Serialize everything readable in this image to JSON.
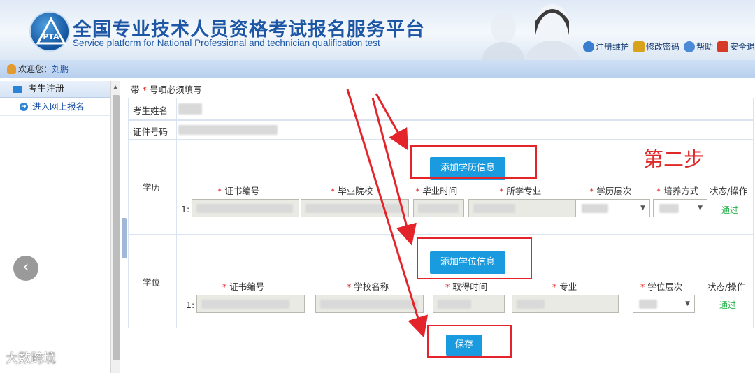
{
  "header": {
    "title_cn": "全国专业技术人员资格考试报名服务平台",
    "title_en": "Service platform for National Professional and technician qualification test",
    "logo_text": "PTA",
    "links": [
      "注册维护",
      "修改密码",
      "帮助",
      "安全退"
    ]
  },
  "welcome": {
    "prefix": "欢迎您：",
    "user": "刘鹏"
  },
  "sidebar": {
    "section": "考生注册",
    "item": "进入网上报名",
    "nav_glyph": "‹"
  },
  "form": {
    "hint_prefix": "带",
    "hint_star": "*",
    "hint_suffix": "号项必须填写",
    "name_label": "考生姓名",
    "id_label": "证件号码",
    "edu": {
      "label": "学历",
      "add_button": "添加学历信息",
      "columns": [
        "证书编号",
        "毕业院校",
        "毕业时间",
        "所学专业",
        "学历层次",
        "培养方式",
        "状态/操作"
      ],
      "row_no": "1:",
      "status": "通过"
    },
    "degree": {
      "label": "学位",
      "add_button": "添加学位信息",
      "columns": [
        "证书编号",
        "学校名称",
        "取得时间",
        "专业",
        "学位层次",
        "状态/操作"
      ],
      "row_no": "1:",
      "status": "通过"
    },
    "save_button": "保存",
    "required_mark": "*"
  },
  "annotation": {
    "step": "第二步",
    "color": "#e3252b"
  },
  "watermark": "大数跨境",
  "colors": {
    "button": "#1a9be0",
    "title": "#1d56a4",
    "pass": "#27b14a"
  }
}
